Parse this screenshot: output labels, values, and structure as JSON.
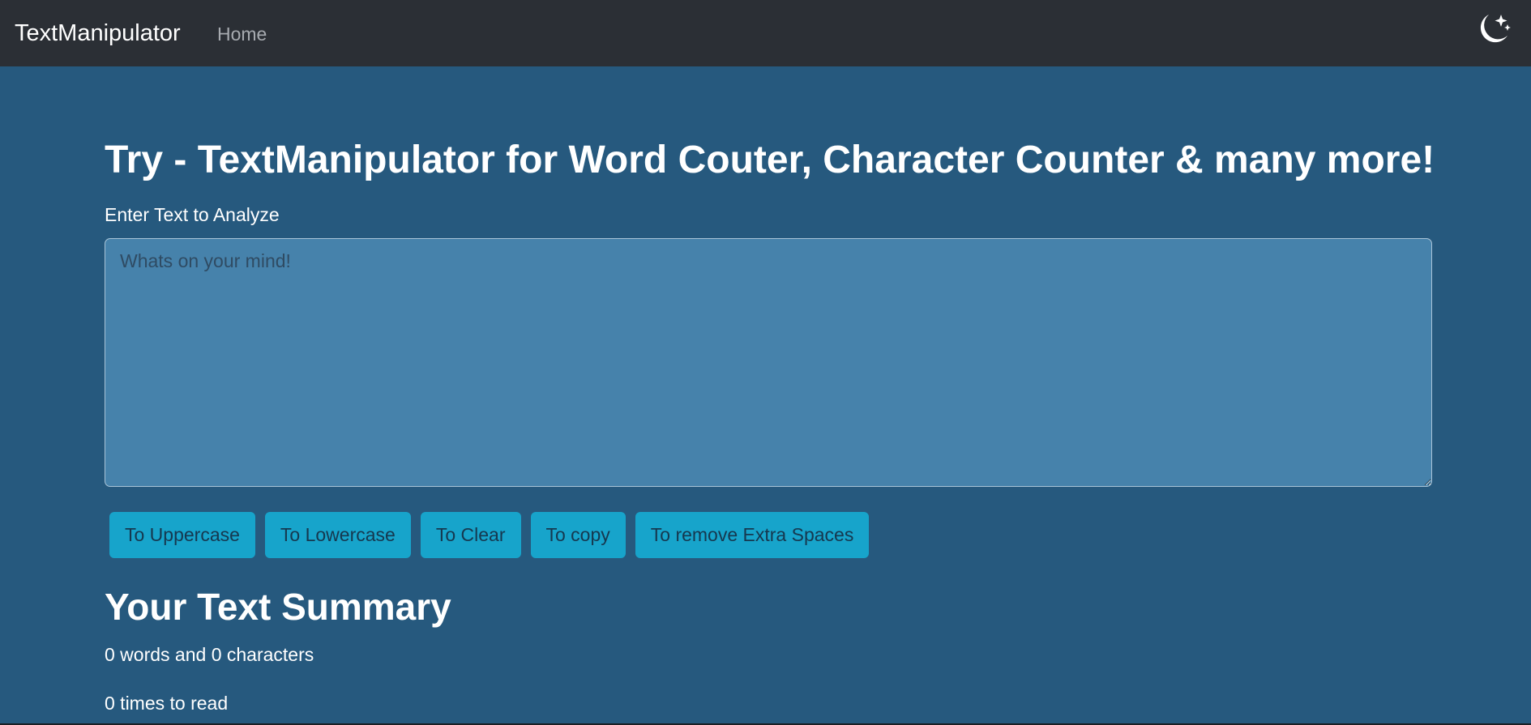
{
  "navbar": {
    "brand": "TextManipulator",
    "links": [
      {
        "label": "Home"
      }
    ],
    "theme_icon": "moon-stars-icon"
  },
  "main": {
    "heading": "Try - TextManipulator for Word Couter, Character Counter & many more!",
    "input_label": "Enter Text to Analyze",
    "textarea": {
      "value": "",
      "placeholder": "Whats on your mind!"
    },
    "buttons": [
      {
        "label": "To Uppercase"
      },
      {
        "label": "To Lowercase"
      },
      {
        "label": "To Clear"
      },
      {
        "label": "To copy"
      },
      {
        "label": "To remove Extra Spaces"
      }
    ]
  },
  "summary": {
    "heading": "Your Text Summary",
    "counts": "0 words and 0 characters",
    "read_time": "0 times to read"
  },
  "colors": {
    "navbar_bg": "#2b2f35",
    "page_bg": "#26597e",
    "textarea_bg": "#4682ab",
    "button_bg": "#17a4cb"
  }
}
